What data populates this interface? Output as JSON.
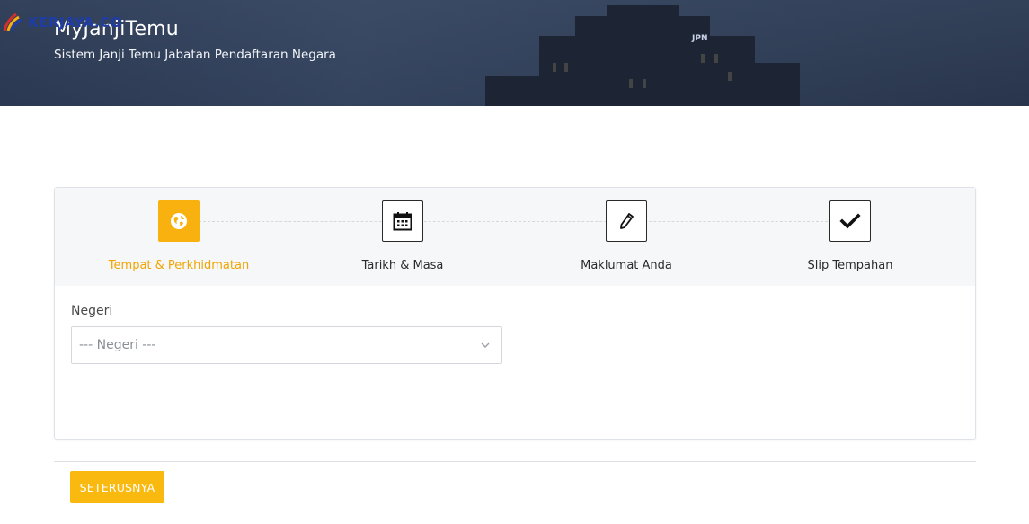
{
  "header": {
    "title": "MyJanjiTemu",
    "subtitle": "Sistem Janji Temu Jabatan Pendaftaran Negara",
    "building_sign": "JPN"
  },
  "watermark": {
    "text": "KERJAYA.CO"
  },
  "steps": [
    {
      "label": "Tempat & Perkhidmatan",
      "icon": "globe-icon",
      "active": true
    },
    {
      "label": "Tarikh & Masa",
      "icon": "calendar-icon",
      "active": false
    },
    {
      "label": "Maklumat Anda",
      "icon": "pencil-icon",
      "active": false
    },
    {
      "label": "Slip Tempahan",
      "icon": "checkmark-icon",
      "active": false
    }
  ],
  "form": {
    "negeri_label": "Negeri",
    "negeri_select": {
      "selected": "--- Negeri ---"
    }
  },
  "actions": {
    "next_label": "SETERUSNYA"
  },
  "colors": {
    "accent": "#f9b10f",
    "active_step_text": "#f0a500",
    "banner_bg": "#34435d"
  }
}
